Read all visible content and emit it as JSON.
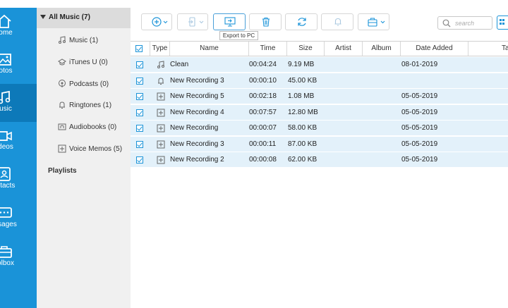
{
  "nav": {
    "items": [
      {
        "label": "Home",
        "icon": "home-icon"
      },
      {
        "label": "Photos",
        "icon": "photos-icon"
      },
      {
        "label": "Music",
        "icon": "music-icon"
      },
      {
        "label": "Videos",
        "icon": "videos-icon"
      },
      {
        "label": "Contacts",
        "icon": "contacts-icon"
      },
      {
        "label": "Messages",
        "icon": "messages-icon"
      },
      {
        "label": "Toolbox",
        "icon": "toolbox-icon"
      }
    ],
    "active": "Music",
    "visible_labels": [
      "ome",
      "otos",
      "usic",
      "deos",
      "ntacts",
      "ssages",
      "olbox"
    ]
  },
  "categories": {
    "header": "All Music (7)",
    "items": [
      {
        "label": "Music (1)",
        "icon": "music-note-icon"
      },
      {
        "label": "iTunes U (0)",
        "icon": "itunes-u-icon"
      },
      {
        "label": "Podcasts (0)",
        "icon": "podcast-icon"
      },
      {
        "label": "Ringtones (1)",
        "icon": "bell-icon"
      },
      {
        "label": "Audiobooks (0)",
        "icon": "audiobook-icon"
      },
      {
        "label": "Voice Memos (5)",
        "icon": "voice-memo-icon"
      }
    ],
    "playlists": "Playlists"
  },
  "toolbar": {
    "add": "add-icon",
    "import": "import-to-device-icon",
    "export": "export-to-pc-icon",
    "delete": "trash-icon",
    "refresh": "refresh-icon",
    "ringtone": "bell-icon",
    "toolbox": "briefcase-icon",
    "tooltip": "Export to PC",
    "search_placeholder": "search"
  },
  "table": {
    "columns": [
      "Type",
      "Name",
      "Time",
      "Size",
      "Artist",
      "Album",
      "Date Added",
      "Tab"
    ],
    "rows": [
      {
        "type_icon": "music-note-icon",
        "name": "Clean",
        "time": "00:04:24",
        "size": "9.19 MB",
        "artist": "",
        "album": "",
        "date": "08-01-2019"
      },
      {
        "type_icon": "bell-icon",
        "name": "New Recording 3",
        "time": "00:00:10",
        "size": "45.00 KB",
        "artist": "",
        "album": "",
        "date": ""
      },
      {
        "type_icon": "voice-memo-icon",
        "name": "New Recording 5",
        "time": "00:02:18",
        "size": "1.08 MB",
        "artist": "",
        "album": "",
        "date": "05-05-2019"
      },
      {
        "type_icon": "voice-memo-icon",
        "name": "New Recording 4",
        "time": "00:07:57",
        "size": "12.80 MB",
        "artist": "",
        "album": "",
        "date": "05-05-2019"
      },
      {
        "type_icon": "voice-memo-icon",
        "name": "New Recording",
        "time": "00:00:07",
        "size": "58.00 KB",
        "artist": "",
        "album": "",
        "date": "05-05-2019"
      },
      {
        "type_icon": "voice-memo-icon",
        "name": "New Recording 3",
        "time": "00:00:11",
        "size": "87.00 KB",
        "artist": "",
        "album": "",
        "date": "05-05-2019"
      },
      {
        "type_icon": "voice-memo-icon",
        "name": "New Recording 2",
        "time": "00:00:08",
        "size": "62.00 KB",
        "artist": "",
        "album": "",
        "date": "05-05-2019"
      }
    ]
  },
  "colors": {
    "accent": "#1a93d8",
    "nav_active": "#0d79b9",
    "row_bg": "#e3f1fa"
  }
}
